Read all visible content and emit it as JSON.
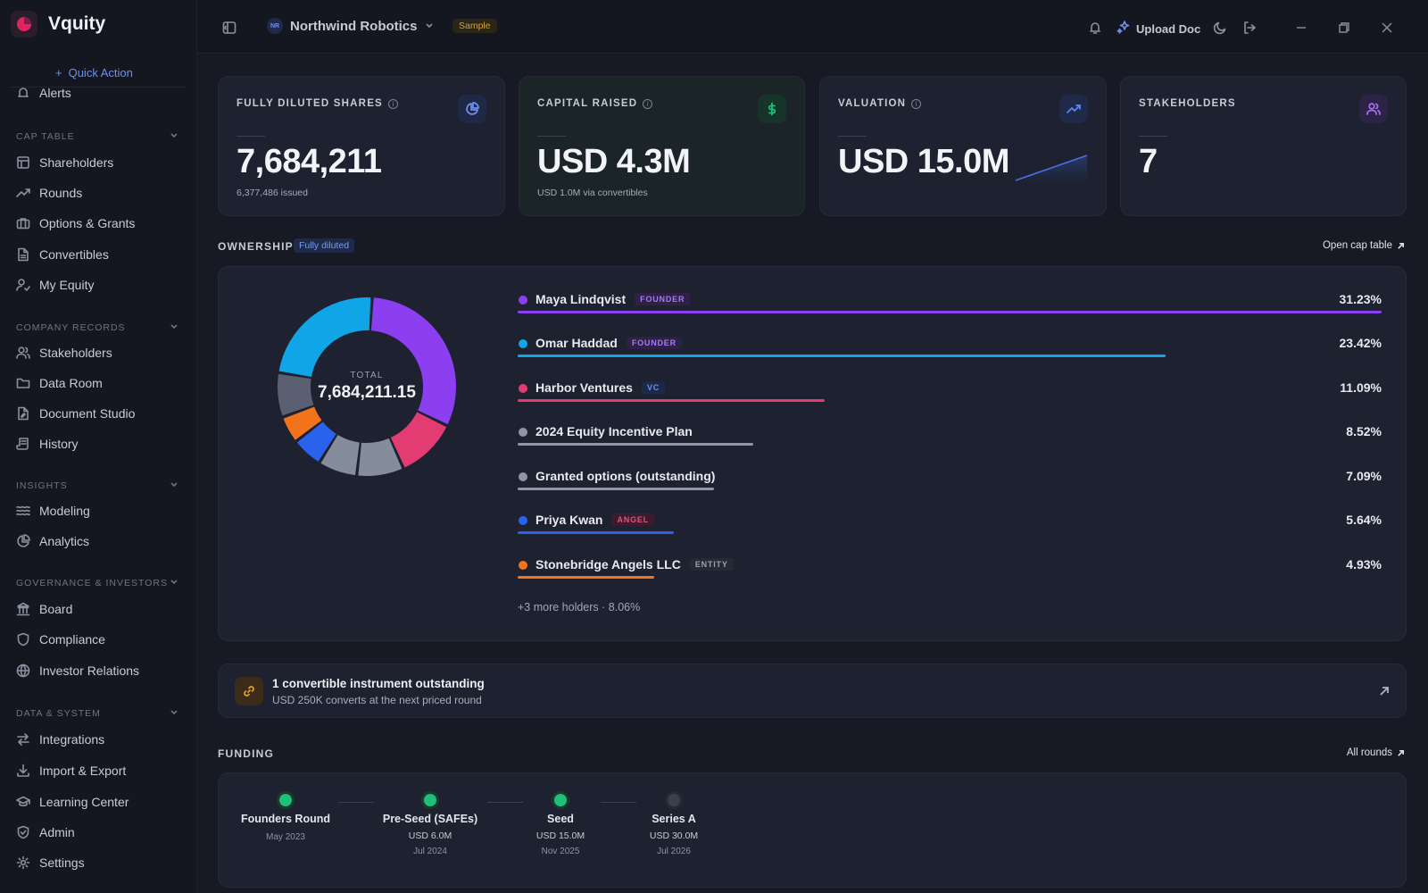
{
  "brand": {
    "name": "Vquity"
  },
  "sidebar": {
    "quick_action": "Quick Action",
    "cut_item": "Alerts",
    "sections": [
      {
        "title": "CAP TABLE",
        "items": [
          "Shareholders",
          "Rounds",
          "Options & Grants",
          "Convertibles",
          "My Equity"
        ]
      },
      {
        "title": "COMPANY RECORDS",
        "items": [
          "Stakeholders",
          "Data Room",
          "Document Studio",
          "History"
        ]
      },
      {
        "title": "INSIGHTS",
        "items": [
          "Modeling",
          "Analytics"
        ]
      },
      {
        "title": "GOVERNANCE & INVESTORS",
        "items": [
          "Board",
          "Compliance",
          "Investor Relations"
        ]
      },
      {
        "title": "DATA & SYSTEM",
        "items": [
          "Integrations",
          "Import & Export",
          "Learning Center",
          "Admin",
          "Settings"
        ]
      }
    ]
  },
  "topbar": {
    "org_initials": "NR",
    "org_name": "Northwind Robotics",
    "badge": "Sample",
    "upload": "Upload Doc"
  },
  "stats": [
    {
      "label": "FULLY DILUTED SHARES",
      "value": "7,684,211",
      "sub": "6,377,486 issued",
      "icon": "pie-chart-icon",
      "color": "#6f8ff0"
    },
    {
      "label": "CAPITAL RAISED",
      "value": "USD 4.3M",
      "sub": "USD 1.0M via convertibles",
      "icon": "dollar-icon",
      "color": "#1fbf7a"
    },
    {
      "label": "VALUATION",
      "value": "USD 15.0M",
      "sub": "",
      "icon": "trending-up-icon",
      "color": "#5b86f0"
    },
    {
      "label": "STAKEHOLDERS",
      "value": "7",
      "sub": "",
      "icon": "users-icon",
      "color": "#a56cf0"
    }
  ],
  "ownership": {
    "title": "OWNERSHIP",
    "badge": "Fully diluted",
    "link": "Open cap table",
    "total_label": "TOTAL",
    "total_value": "7,684,211.15",
    "holders": [
      {
        "name": "Maya Lindqvist",
        "tag": "FOUNDER",
        "pct": "31.23%",
        "value": 31.23,
        "color": "#8b3ff0"
      },
      {
        "name": "Omar Haddad",
        "tag": "FOUNDER",
        "pct": "23.42%",
        "value": 23.42,
        "color": "#10a5e6"
      },
      {
        "name": "Harbor Ventures",
        "tag": "VC",
        "pct": "11.09%",
        "value": 11.09,
        "color": "#e23c72"
      },
      {
        "name": "2024 Equity Incentive Plan",
        "tag": "",
        "pct": "8.52%",
        "value": 8.52,
        "color": "#8e95a3"
      },
      {
        "name": "Granted options (outstanding)",
        "tag": "",
        "pct": "7.09%",
        "value": 7.09,
        "color": "#8e95a3"
      },
      {
        "name": "Priya Kwan",
        "tag": "ANGEL",
        "pct": "5.64%",
        "value": 5.64,
        "color": "#2a63eb"
      },
      {
        "name": "Stonebridge Angels LLC",
        "tag": "ENTITY",
        "pct": "4.93%",
        "value": 4.93,
        "color": "#f2731a"
      }
    ],
    "more": "+3 more holders · 8.06%"
  },
  "convertible": {
    "title": "1 convertible instrument outstanding",
    "subtitle": "USD 250K converts at the next priced round"
  },
  "funding": {
    "title": "FUNDING",
    "link": "All rounds",
    "rounds": [
      {
        "name": "Founders Round",
        "amount": "",
        "date": "May 2023",
        "status": "done"
      },
      {
        "name": "Pre-Seed (SAFEs)",
        "amount": "USD 6.0M",
        "date": "Jul 2024",
        "status": "done"
      },
      {
        "name": "Seed",
        "amount": "USD 15.0M",
        "date": "Nov 2025",
        "status": "done"
      },
      {
        "name": "Series A",
        "amount": "USD 30.0M",
        "date": "Jul 2026",
        "status": "planned"
      }
    ]
  },
  "colors": {
    "accent": "#6f8ff0",
    "done": "#1fbf7a",
    "planned": "#3a3f4d",
    "warning": "#e39b2d"
  }
}
